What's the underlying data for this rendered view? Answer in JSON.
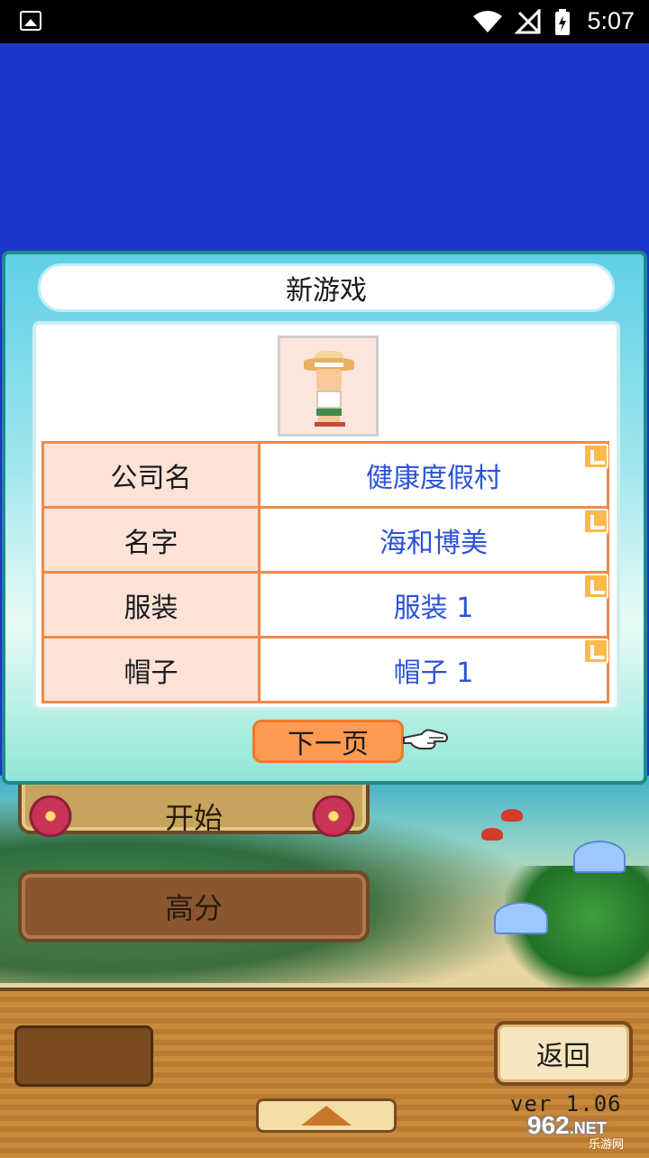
{
  "status_bar": {
    "time": "5:07",
    "icons": [
      "image-icon",
      "wifi-icon",
      "no-signal-icon",
      "battery-charging-icon"
    ]
  },
  "dialog": {
    "title": "新游戏",
    "portrait_icon": "character-straw-hat-icon",
    "rows": [
      {
        "label": "公司名",
        "value": "健康度假村"
      },
      {
        "label": "名字",
        "value": "海和博美"
      },
      {
        "label": "服装",
        "value": "服装 1"
      },
      {
        "label": "帽子",
        "value": "帽子 1"
      }
    ],
    "edit_icon": "edit-pencil-icon",
    "next_label": "下一页",
    "pointer_icon": "pointing-hand-icon"
  },
  "menu": {
    "start_label": "开始",
    "high_score_label": "高分"
  },
  "bottom_bar": {
    "back_label": "返回",
    "up_icon": "up-arrow-icon",
    "version": "ver 1.06"
  },
  "watermark": {
    "brand": "962",
    "suffix": ".NET",
    "text": "乐游网"
  },
  "colors": {
    "sky": "#1b37c9",
    "value_text": "#2a52d8",
    "row_border": "#f08a4a",
    "next_button": "#ff9a52"
  }
}
